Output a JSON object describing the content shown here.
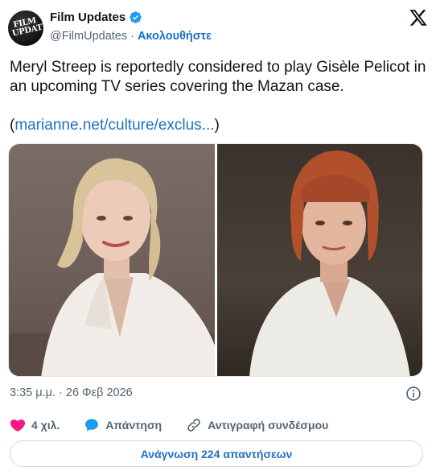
{
  "account": {
    "avatar_text": "FILM UPDATES",
    "name": "Film Updates",
    "handle": "@FilmUpdates",
    "separator": "·",
    "follow_label": "Ακολουθήστε"
  },
  "post": {
    "text": "Meryl Streep is reportedly considered to play Gisèle Pelicot in an upcoming TV series covering the Mazan case.",
    "link_open": "(",
    "link_text": "marianne.net/culture/exclus...",
    "link_close": ")",
    "timestamp": "3:35 μ.μ. · 26 Φεβ 2026"
  },
  "actions": {
    "like_count": "4 χιλ.",
    "reply_label": "Απάντηση",
    "copy_link_label": "Αντιγραφή συνδέσμου"
  },
  "read_replies_label": "Ανάγνωση 224 απαντήσεων",
  "colors": {
    "accent": "#1d6fc4",
    "like": "#f91880",
    "muted": "#536471"
  },
  "icons": [
    "verified-badge-icon",
    "x-logo-icon",
    "info-icon",
    "heart-icon",
    "reply-bubble-icon",
    "link-icon"
  ]
}
